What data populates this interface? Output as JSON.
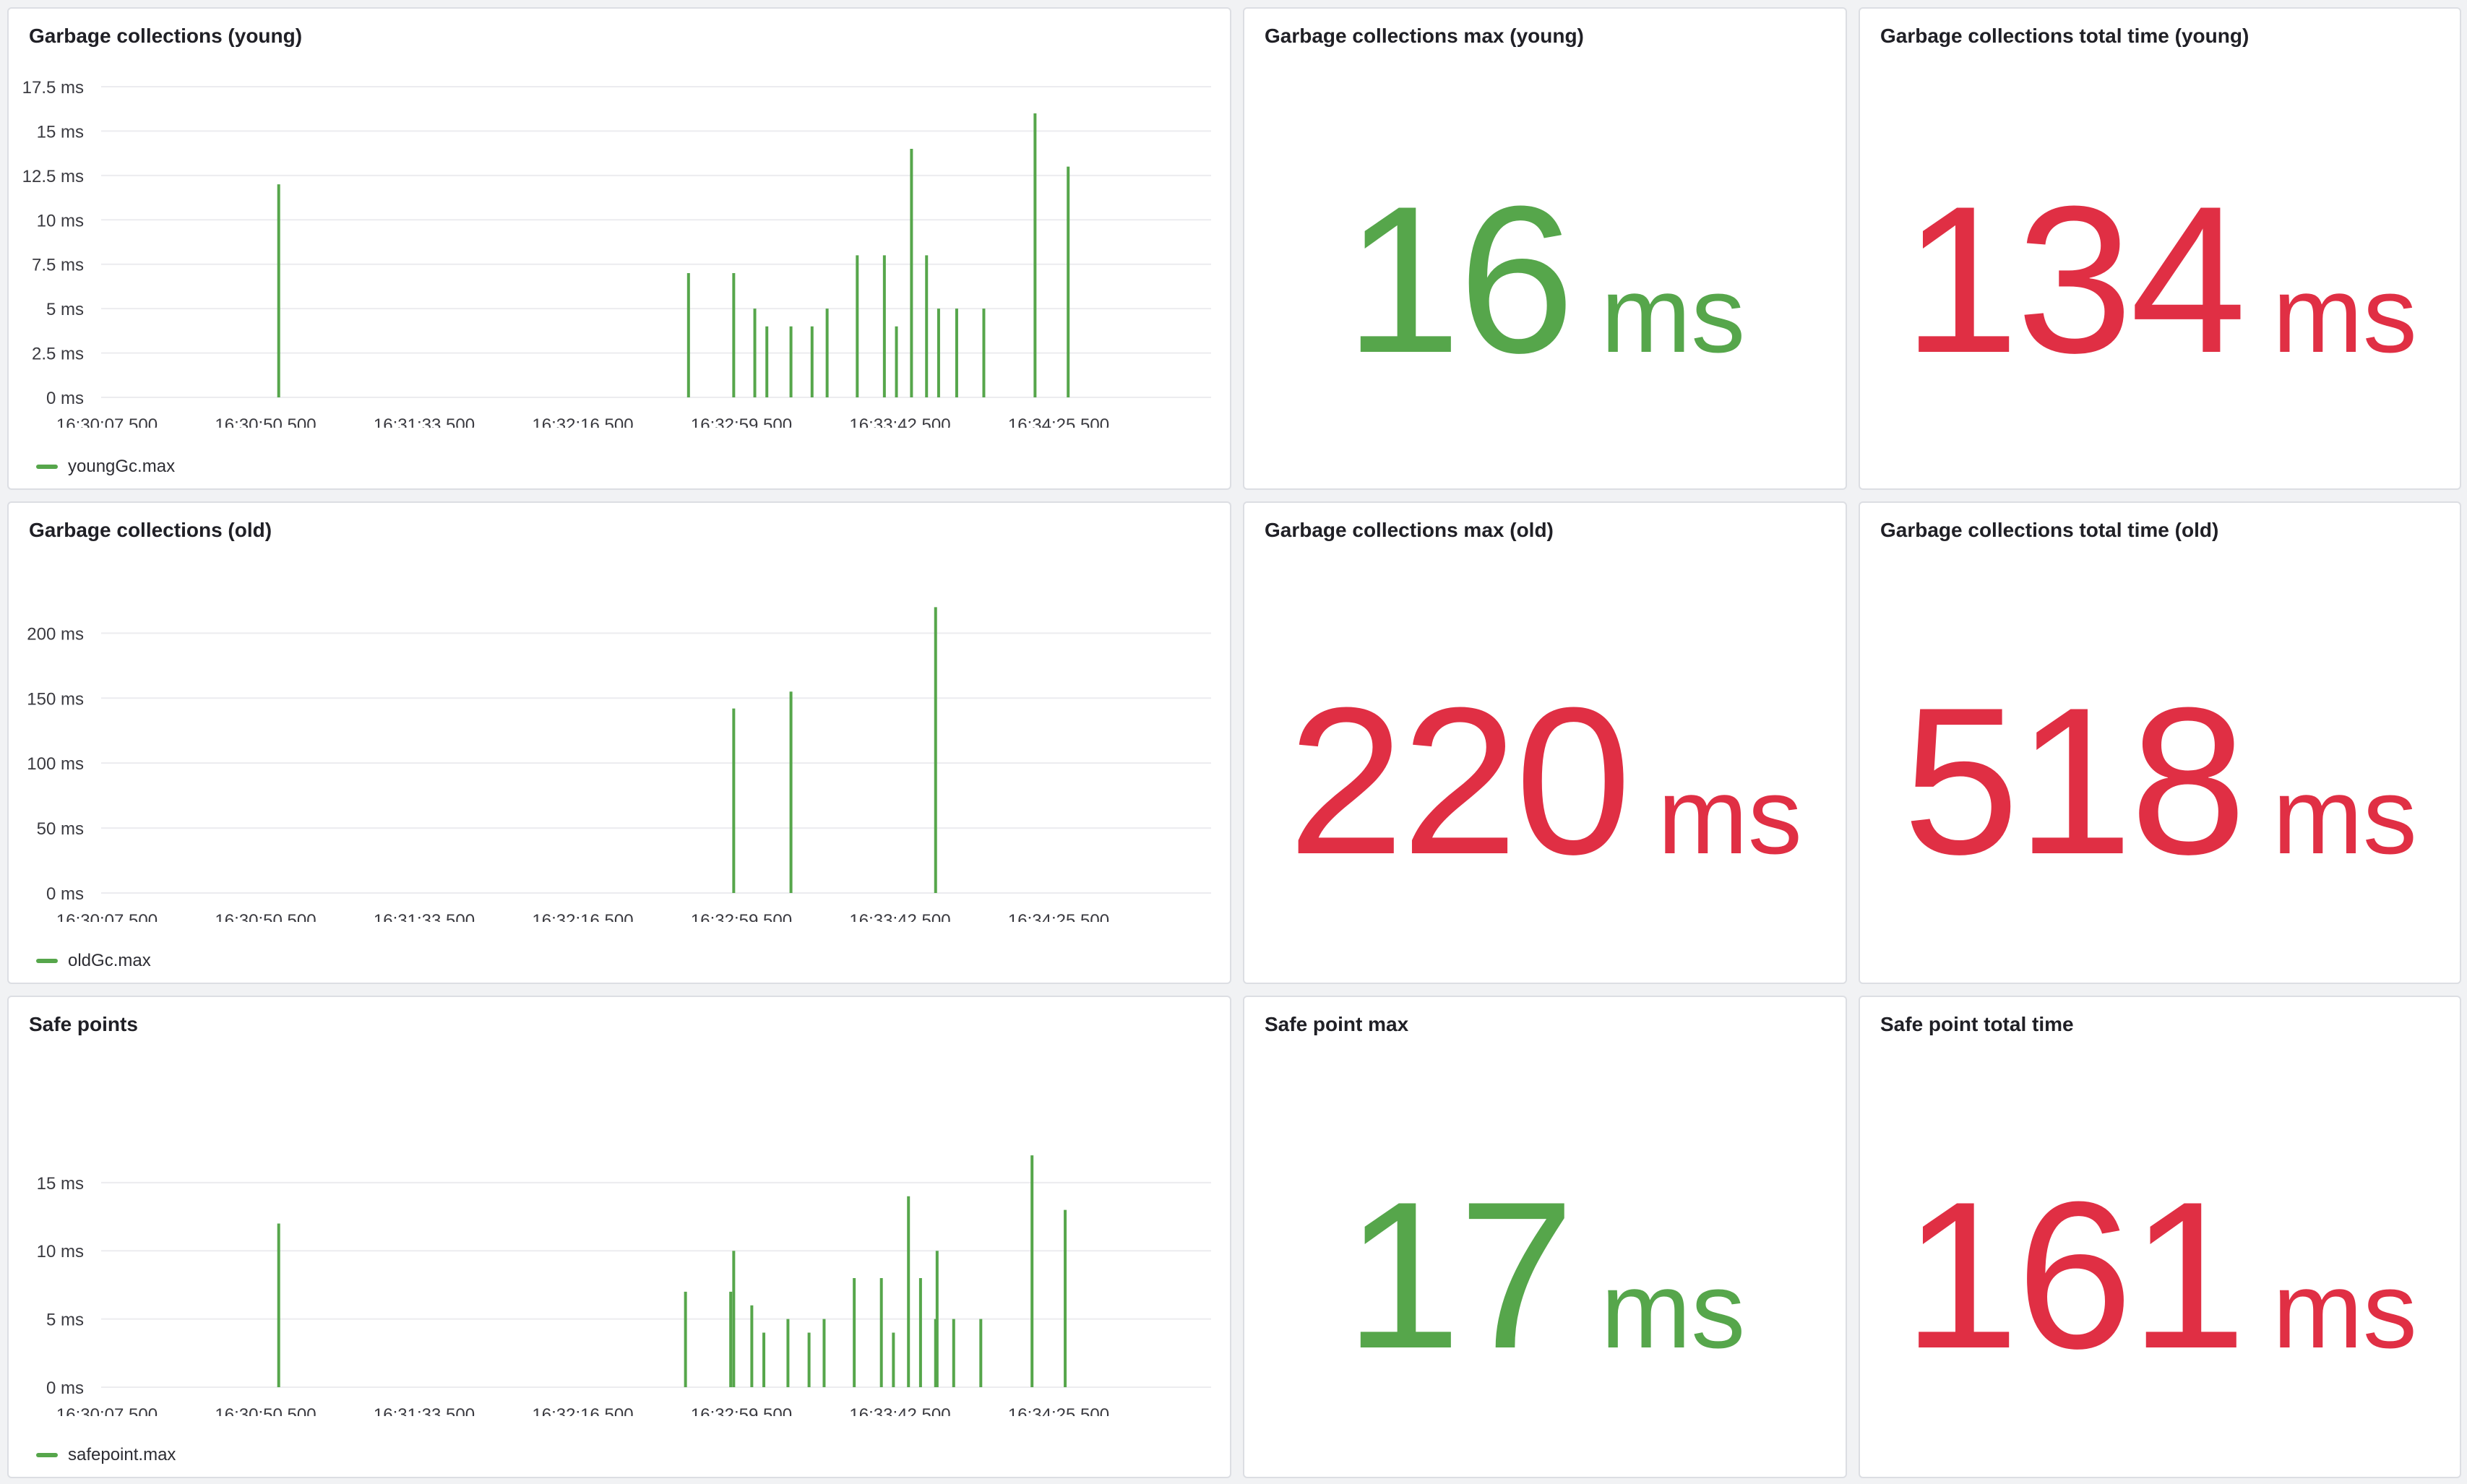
{
  "colors": {
    "green": "#56a64b",
    "red": "#e02f44",
    "grid": "#ececef",
    "axis_text": "#3a3a40"
  },
  "panels": {
    "young_chart": {
      "title": "Garbage collections (young)",
      "legend": "youngGc.max"
    },
    "young_max": {
      "title": "Garbage collections max (young)",
      "value": "16",
      "unit": "ms",
      "color": "#56a64b"
    },
    "young_total": {
      "title": "Garbage collections total time (young)",
      "value": "134",
      "unit": "ms",
      "color": "#e02f44"
    },
    "old_chart": {
      "title": "Garbage collections (old)",
      "legend": "oldGc.max"
    },
    "old_max": {
      "title": "Garbage collections max (old)",
      "value": "220",
      "unit": "ms",
      "color": "#e02f44"
    },
    "old_total": {
      "title": "Garbage collections total time (old)",
      "value": "518",
      "unit": "ms",
      "color": "#e02f44"
    },
    "safe_chart": {
      "title": "Safe points",
      "legend": "safepoint.max"
    },
    "safe_max": {
      "title": "Safe point max",
      "value": "17",
      "unit": "ms",
      "color": "#56a64b"
    },
    "safe_total": {
      "title": "Safe point total time",
      "value": "161",
      "unit": "ms",
      "color": "#e02f44"
    }
  },
  "chart_data": [
    {
      "type": "bar",
      "title": "Garbage collections (young)",
      "series_name": "youngGc.max",
      "x_tick_labels": [
        "16:30:07.500",
        "16:30:50.500",
        "16:31:33.500",
        "16:32:16.500",
        "16:32:59.500",
        "16:33:42.500",
        "16:34:25.500"
      ],
      "x_range": [
        0,
        368
      ],
      "y_ticks": [
        0,
        2.5,
        5,
        7.5,
        10,
        12.5,
        15,
        17.5
      ],
      "y_tick_labels": [
        "0 ms",
        "2.5 ms",
        "5 ms",
        "7.5 ms",
        "10 ms",
        "12.5 ms",
        "15 ms",
        "17.5 ms"
      ],
      "ylim": [
        0,
        17.5
      ],
      "grid": true,
      "legend": "bottom-left",
      "points": [
        {
          "x": 57,
          "y": 12
        },
        {
          "x": 193,
          "y": 7
        },
        {
          "x": 208,
          "y": 7
        },
        {
          "x": 215,
          "y": 5
        },
        {
          "x": 219,
          "y": 4
        },
        {
          "x": 227,
          "y": 4
        },
        {
          "x": 234,
          "y": 4
        },
        {
          "x": 239,
          "y": 5
        },
        {
          "x": 249,
          "y": 8
        },
        {
          "x": 258,
          "y": 8
        },
        {
          "x": 262,
          "y": 4
        },
        {
          "x": 267,
          "y": 14
        },
        {
          "x": 272,
          "y": 8
        },
        {
          "x": 276,
          "y": 5
        },
        {
          "x": 282,
          "y": 5
        },
        {
          "x": 291,
          "y": 5
        },
        {
          "x": 308,
          "y": 16
        },
        {
          "x": 319,
          "y": 13
        }
      ]
    },
    {
      "type": "bar",
      "title": "Garbage collections (old)",
      "series_name": "oldGc.max",
      "x_tick_labels": [
        "16:30:07.500",
        "16:30:50.500",
        "16:31:33.500",
        "16:32:16.500",
        "16:32:59.500",
        "16:33:42.500",
        "16:34:25.500"
      ],
      "x_range": [
        0,
        368
      ],
      "y_ticks": [
        0,
        50,
        100,
        150,
        200
      ],
      "y_tick_labels": [
        "0 ms",
        "50 ms",
        "100 ms",
        "150 ms",
        "200 ms"
      ],
      "ylim": [
        0,
        228
      ],
      "grid": true,
      "legend": "bottom-left",
      "points": [
        {
          "x": 208,
          "y": 142
        },
        {
          "x": 227,
          "y": 155
        },
        {
          "x": 275,
          "y": 220
        }
      ]
    },
    {
      "type": "bar",
      "title": "Safe points",
      "series_name": "safepoint.max",
      "x_tick_labels": [
        "16:30:07.500",
        "16:30:50.500",
        "16:31:33.500",
        "16:32:16.500",
        "16:32:59.500",
        "16:33:42.500",
        "16:34:25.500"
      ],
      "x_range": [
        0,
        368
      ],
      "y_ticks": [
        0,
        5,
        10,
        15
      ],
      "y_tick_labels": [
        "0 ms",
        "5 ms",
        "10 ms",
        "15 ms"
      ],
      "ylim": [
        0,
        19.6
      ],
      "grid": true,
      "legend": "bottom-left",
      "points": [
        {
          "x": 57,
          "y": 12
        },
        {
          "x": 192,
          "y": 7
        },
        {
          "x": 207,
          "y": 7
        },
        {
          "x": 208,
          "y": 10
        },
        {
          "x": 214,
          "y": 6
        },
        {
          "x": 218,
          "y": 4
        },
        {
          "x": 226,
          "y": 5
        },
        {
          "x": 233,
          "y": 4
        },
        {
          "x": 238,
          "y": 5
        },
        {
          "x": 248,
          "y": 8
        },
        {
          "x": 257,
          "y": 8
        },
        {
          "x": 261,
          "y": 4
        },
        {
          "x": 266,
          "y": 14
        },
        {
          "x": 270,
          "y": 8
        },
        {
          "x": 275,
          "y": 5
        },
        {
          "x": 275.5,
          "y": 10
        },
        {
          "x": 281,
          "y": 5
        },
        {
          "x": 290,
          "y": 5
        },
        {
          "x": 307,
          "y": 17
        },
        {
          "x": 318,
          "y": 13
        }
      ]
    }
  ]
}
